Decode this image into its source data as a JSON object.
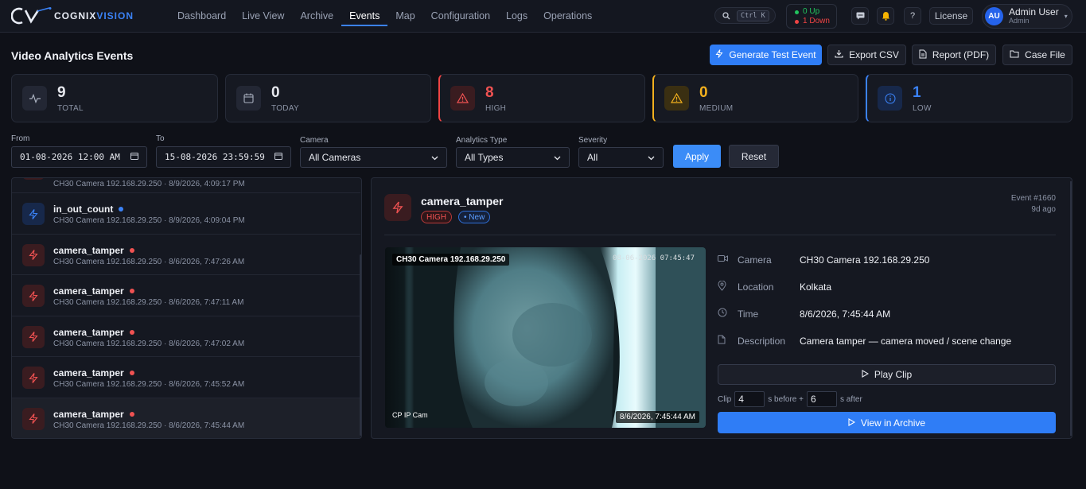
{
  "app": {
    "logo_left": "COGNIX",
    "logo_right": "VISION",
    "nav": [
      "Dashboard",
      "Live View",
      "Archive",
      "Events",
      "Map",
      "Configuration",
      "Logs",
      "Operations"
    ],
    "active_nav": "Events",
    "search_shortcut": "Ctrl K",
    "status": {
      "up_count": "0",
      "up_label": "Up",
      "down_count": "1",
      "down_label": "Down"
    },
    "license_label": "License",
    "user": {
      "initials": "AU",
      "name": "Admin User",
      "role": "Admin"
    }
  },
  "header": {
    "title": "Video Analytics Events",
    "buttons": {
      "generate": "Generate Test Event",
      "export": "Export CSV",
      "report": "Report (PDF)",
      "case": "Case File"
    }
  },
  "stats": [
    {
      "value": "9",
      "label": "TOTAL",
      "color": "#e6e8ee"
    },
    {
      "value": "0",
      "label": "TODAY",
      "color": "#e6e8ee"
    },
    {
      "value": "8",
      "label": "HIGH",
      "color": "#f05252"
    },
    {
      "value": "0",
      "label": "MEDIUM",
      "color": "#f2b01e"
    },
    {
      "value": "1",
      "label": "LOW",
      "color": "#3b82f6"
    }
  ],
  "filters": {
    "from_label": "From",
    "from_value": "01-08-2026 12:00 AM",
    "to_label": "To",
    "to_value": "15-08-2026 23:59:59",
    "camera_label": "Camera",
    "camera_value": "All Cameras",
    "type_label": "Analytics Type",
    "type_value": "All Types",
    "severity_label": "Severity",
    "severity_value": "All",
    "apply": "Apply",
    "reset": "Reset"
  },
  "events": [
    {
      "title": "",
      "sub": "CH30 Camera 192.168.29.250 · 8/9/2026, 4:09:17 PM",
      "severity": "high"
    },
    {
      "title": "in_out_count",
      "sub": "CH30 Camera 192.168.29.250 · 8/9/2026, 4:09:04 PM",
      "severity": "low"
    },
    {
      "title": "camera_tamper",
      "sub": "CH30 Camera 192.168.29.250 · 8/6/2026, 7:47:26 AM",
      "severity": "high"
    },
    {
      "title": "camera_tamper",
      "sub": "CH30 Camera 192.168.29.250 · 8/6/2026, 7:47:11 AM",
      "severity": "high"
    },
    {
      "title": "camera_tamper",
      "sub": "CH30 Camera 192.168.29.250 · 8/6/2026, 7:47:02 AM",
      "severity": "high"
    },
    {
      "title": "camera_tamper",
      "sub": "CH30 Camera 192.168.29.250 · 8/6/2026, 7:45:52 AM",
      "severity": "high"
    },
    {
      "title": "camera_tamper",
      "sub": "CH30 Camera 192.168.29.250 · 8/6/2026, 7:45:44 AM",
      "severity": "high"
    }
  ],
  "detail": {
    "title": "camera_tamper",
    "severity_badge": "HIGH",
    "new_badge": "• New",
    "event_no": "Event #1660",
    "ago": "9d ago",
    "video": {
      "overlay_camera": "CH30 Camera 192.168.29.250",
      "overlay_time": "08-06-2026 07:45:47",
      "cam_label": "CP IP Cam",
      "captured": "8/6/2026, 7:45:44 AM"
    },
    "fields": [
      {
        "key": "Camera",
        "value": "CH30 Camera 192.168.29.250",
        "icon": "video-camera-icon"
      },
      {
        "key": "Location",
        "value": "Kolkata",
        "icon": "map-pin-icon"
      },
      {
        "key": "Time",
        "value": "8/6/2026, 7:45:44 AM",
        "icon": "clock-icon"
      },
      {
        "key": "Description",
        "value": "Camera tamper — camera moved / scene change",
        "icon": "document-icon"
      }
    ],
    "play_clip": "Play Clip",
    "clip": {
      "prefix": "Clip",
      "before": "4",
      "before_label": "s before +",
      "after": "6",
      "after_label": "s after"
    },
    "view_archive": "View in Archive"
  }
}
